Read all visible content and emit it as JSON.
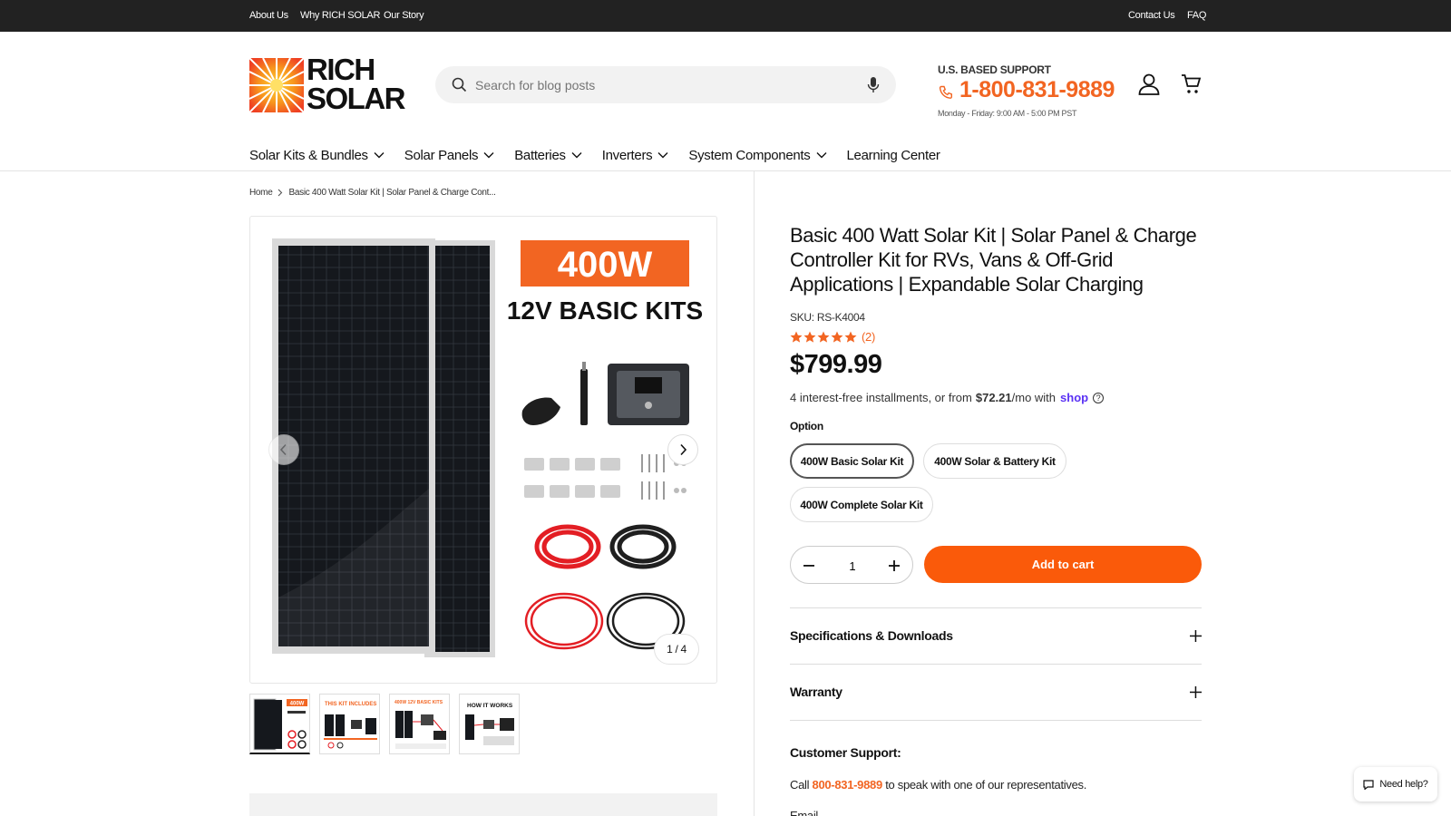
{
  "topbar": {
    "left_links": [
      "About Us",
      "Why RICH SOLAR",
      "Our Story"
    ],
    "right_links": [
      "Contact Us",
      "FAQ"
    ]
  },
  "header": {
    "logo_line1": "RICH",
    "logo_line2": "SOLAR",
    "search_placeholder": "Search for blog posts",
    "support_title": "U.S. BASED SUPPORT",
    "phone": "1-800-831-9889",
    "hours": "Monday - Friday: 9:00 AM - 5:00 PM PST"
  },
  "nav": {
    "items": [
      {
        "label": "Solar Kits & Bundles",
        "dropdown": true
      },
      {
        "label": "Solar Panels",
        "dropdown": true
      },
      {
        "label": "Batteries",
        "dropdown": true
      },
      {
        "label": "Inverters",
        "dropdown": true
      },
      {
        "label": "System Components",
        "dropdown": true
      },
      {
        "label": "Learning Center",
        "dropdown": false
      }
    ]
  },
  "breadcrumb": {
    "home": "Home",
    "current": "Basic 400 Watt Solar Kit | Solar Panel & Charge Cont..."
  },
  "gallery": {
    "badge": "400W",
    "headline": "12V BASIC KITS",
    "counter": "1 / 4",
    "thumb_captions": [
      "400W",
      "THIS KIT INCLUDES",
      "400W 12V BASIC KITS",
      "HOW IT WORKS"
    ]
  },
  "product": {
    "title": "Basic 400 Watt Solar Kit | Solar Panel & Charge Controller Kit for RVs, Vans & Off-Grid Applications | Expandable Solar Charging",
    "sku": "SKU: RS-K4004",
    "rating": 5,
    "review_count": "(2)",
    "price": "$799.99",
    "installments_text": "4 interest-free installments, or from",
    "installments_amount": "$72.21",
    "installments_suffix": "/mo with",
    "shop_label": "shop",
    "option_label": "Option",
    "options": [
      "400W Basic Solar Kit",
      "400W Solar & Battery Kit",
      "400W Complete Solar Kit"
    ],
    "selected_option": "400W Basic Solar Kit",
    "quantity": "1",
    "add_to_cart": "Add to cart"
  },
  "accordions": [
    "Specifications & Downloads",
    "Warranty"
  ],
  "support": {
    "title": "Customer Support:",
    "call_prefix": "Call",
    "call_number": "800-831-9889",
    "call_suffix": "to speak with one of our representatives.",
    "email_prefix": "Email"
  },
  "chat": {
    "label": "Need help?"
  },
  "colors": {
    "accent": "#f26522",
    "cart_button": "#fa5a0a",
    "topbar": "#222222",
    "shop_pay": "#5a31f4"
  }
}
